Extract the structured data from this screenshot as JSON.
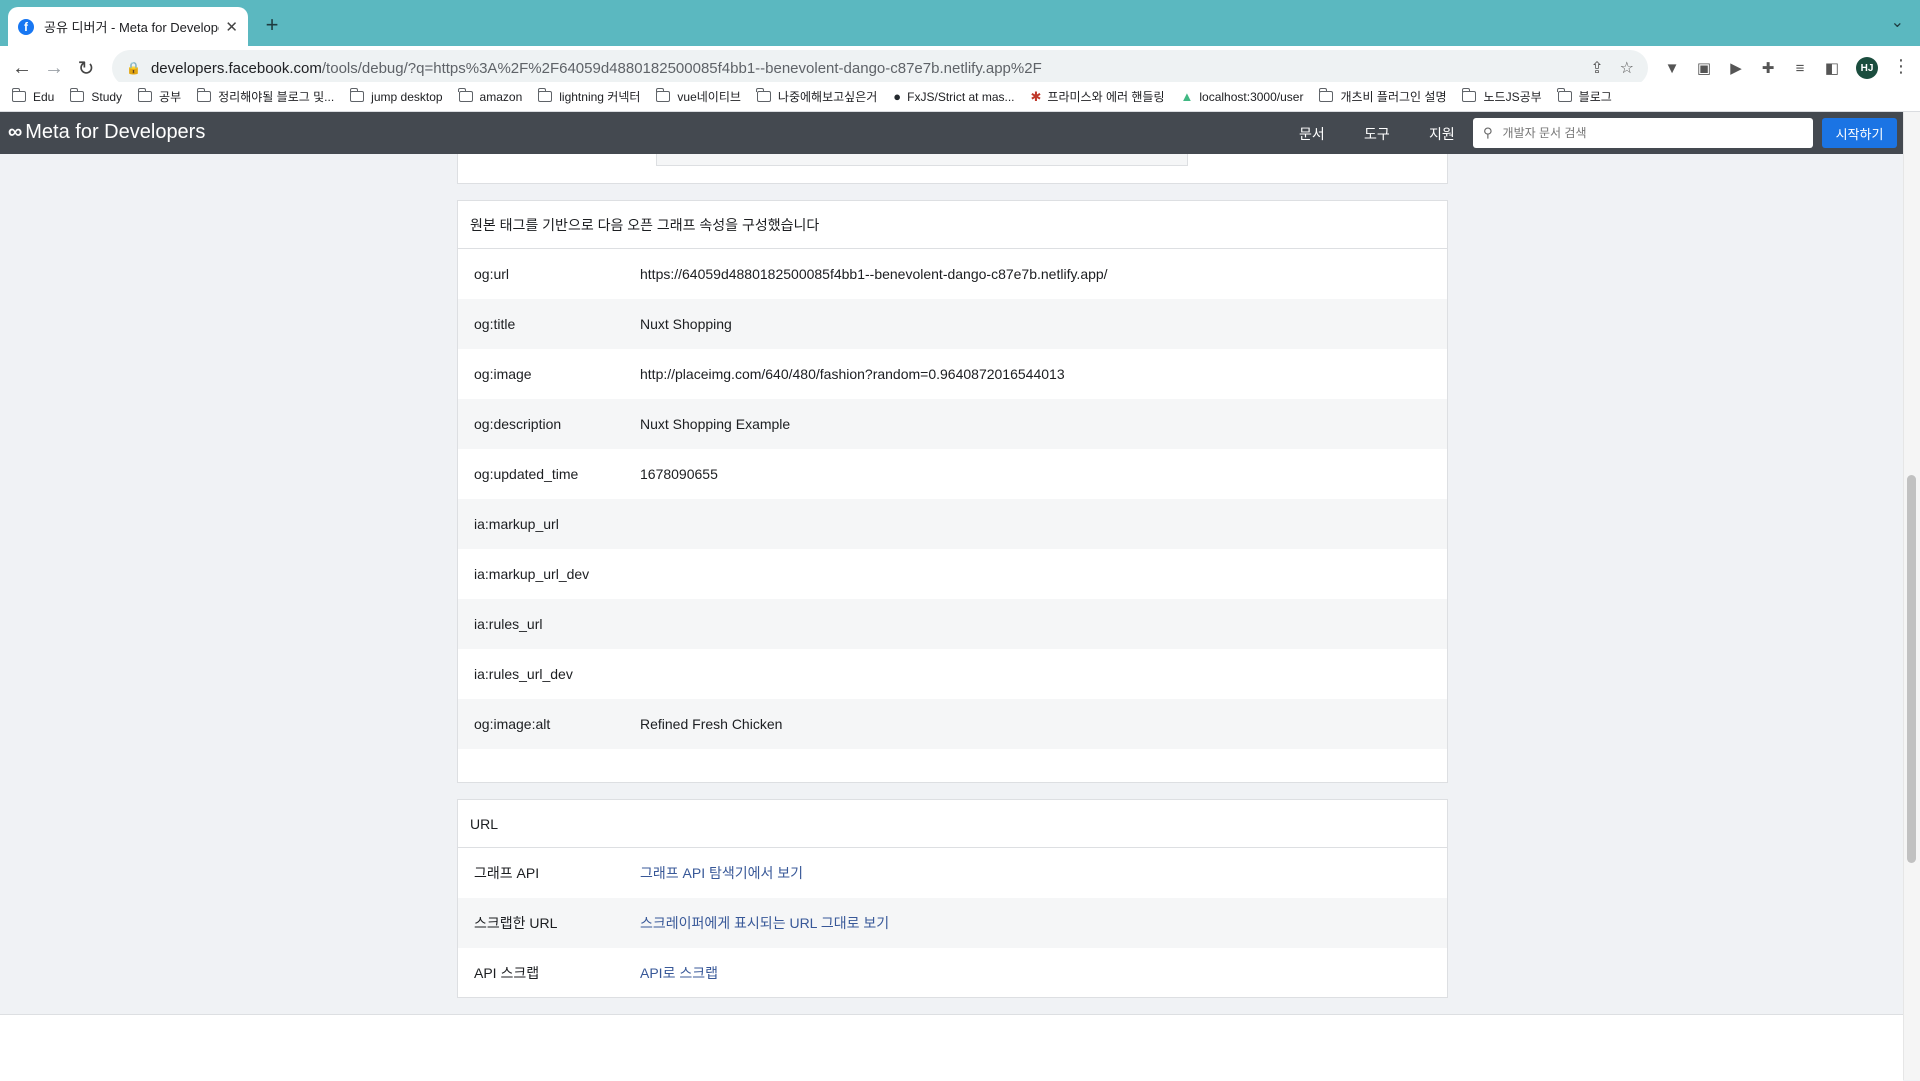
{
  "browser": {
    "tab_title": "공유 디버거 - Meta for Developers",
    "new_tab_symbol": "+",
    "url_host": "developers.facebook.com",
    "url_path": "/tools/debug/?q=https%3A%2F%2F64059d4880182500085f4bb1--benevolent-dango-c87e7b.netlify.app%2F",
    "profile_initials": "HJ"
  },
  "bookmarks": [
    {
      "label": "Edu",
      "icon": "folder"
    },
    {
      "label": "Study",
      "icon": "folder"
    },
    {
      "label": "공부",
      "icon": "folder"
    },
    {
      "label": "정리해야될 블로그 및...",
      "icon": "folder"
    },
    {
      "label": "jump desktop",
      "icon": "folder"
    },
    {
      "label": "amazon",
      "icon": "folder"
    },
    {
      "label": "lightning 커넥터",
      "icon": "folder"
    },
    {
      "label": "vue네이티브",
      "icon": "folder"
    },
    {
      "label": "나중에해보고싶은거",
      "icon": "folder"
    },
    {
      "label": "FxJS/Strict at mas...",
      "icon": "github"
    },
    {
      "label": "프라미스와 에러 핸들링",
      "icon": "javascript"
    },
    {
      "label": "localhost:3000/user",
      "icon": "vue"
    },
    {
      "label": "개츠비 플러그인 설명",
      "icon": "folder"
    },
    {
      "label": "노드JS공부",
      "icon": "folder"
    },
    {
      "label": "블로그",
      "icon": "folder"
    }
  ],
  "header": {
    "logo_text": "Meta for Developers",
    "nav": [
      "문서",
      "도구",
      "지원"
    ],
    "search_placeholder": "개발자 문서 검색",
    "start_button": "시작하기"
  },
  "og_section": {
    "heading": "원본 태그를 기반으로 다음 오픈 그래프 속성을 구성했습니다",
    "rows": [
      {
        "key": "og:url",
        "value": "https://64059d4880182500085f4bb1--benevolent-dango-c87e7b.netlify.app/"
      },
      {
        "key": "og:title",
        "value": "Nuxt Shopping"
      },
      {
        "key": "og:image",
        "value": "http://placeimg.com/640/480/fashion?random=0.9640872016544013"
      },
      {
        "key": "og:description",
        "value": "Nuxt Shopping Example"
      },
      {
        "key": "og:updated_time",
        "value": "1678090655"
      },
      {
        "key": "ia:markup_url",
        "value": ""
      },
      {
        "key": "ia:markup_url_dev",
        "value": ""
      },
      {
        "key": "ia:rules_url",
        "value": ""
      },
      {
        "key": "ia:rules_url_dev",
        "value": ""
      },
      {
        "key": "og:image:alt",
        "value": "Refined Fresh Chicken"
      }
    ]
  },
  "url_section": {
    "heading": "URL",
    "rows": [
      {
        "key": "그래프 API",
        "value": "그래프 API 탐색기에서 보기"
      },
      {
        "key": "스크랩한 URL",
        "value": "스크레이퍼에게 표시되는 URL 그대로 보기"
      },
      {
        "key": "API 스크랩",
        "value": "API로 스크랩"
      }
    ]
  }
}
